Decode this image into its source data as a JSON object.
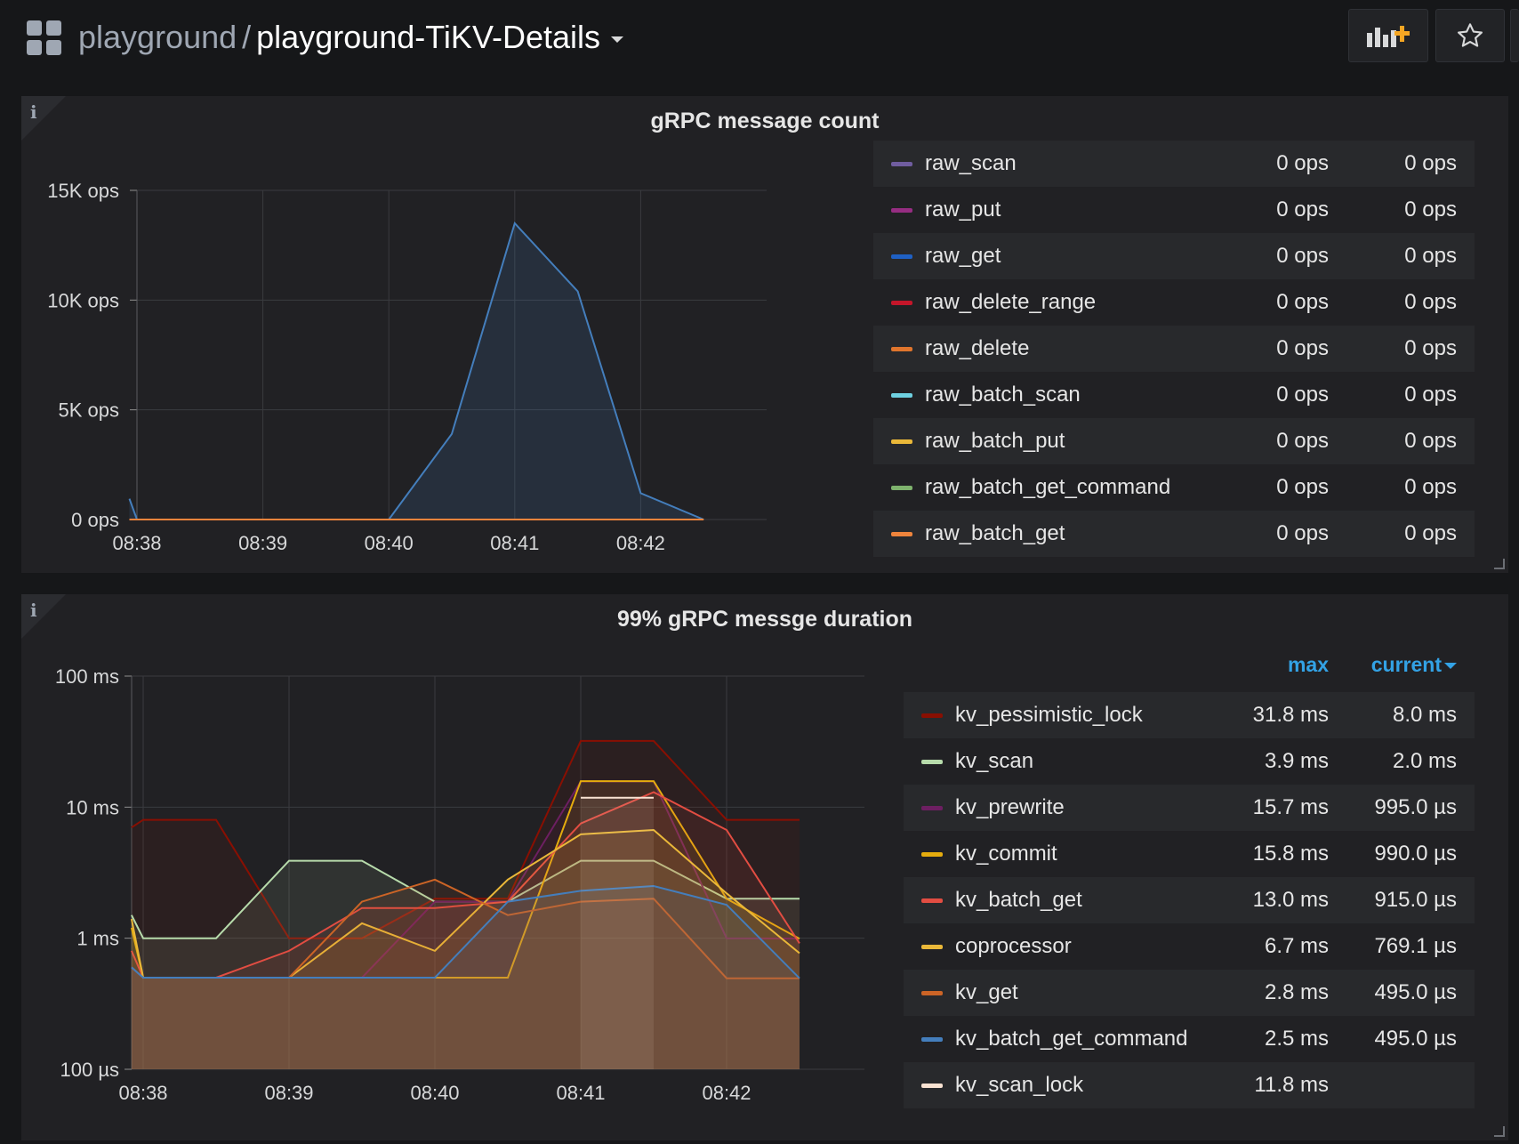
{
  "header": {
    "folder": "playground",
    "separator": "/",
    "dashboard_title": "playground-TiKV-Details"
  },
  "panels": [
    {
      "title": "gRPC message count",
      "legend": {
        "rows": [
          {
            "name": "raw_scan",
            "color": "#705da0",
            "max": "0 ops",
            "current": "0 ops"
          },
          {
            "name": "raw_put",
            "color": "#962d82",
            "max": "0 ops",
            "current": "0 ops"
          },
          {
            "name": "raw_get",
            "color": "#1f60c4",
            "max": "0 ops",
            "current": "0 ops"
          },
          {
            "name": "raw_delete_range",
            "color": "#c4162a",
            "max": "0 ops",
            "current": "0 ops"
          },
          {
            "name": "raw_delete",
            "color": "#e0752d",
            "max": "0 ops",
            "current": "0 ops"
          },
          {
            "name": "raw_batch_scan",
            "color": "#6ed0e0",
            "max": "0 ops",
            "current": "0 ops"
          },
          {
            "name": "raw_batch_put",
            "color": "#eab839",
            "max": "0 ops",
            "current": "0 ops"
          },
          {
            "name": "raw_batch_get_command",
            "color": "#7eb26d",
            "max": "0 ops",
            "current": "0 ops"
          },
          {
            "name": "raw_batch_get",
            "color": "#ef843c",
            "max": "0 ops",
            "current": "0 ops"
          }
        ]
      }
    },
    {
      "title": "99% gRPC messge duration",
      "legend": {
        "max_header": "max",
        "current_header": "current",
        "rows": [
          {
            "name": "kv_pessimistic_lock",
            "color": "#890f02",
            "max": "31.8 ms",
            "current": "8.0 ms"
          },
          {
            "name": "kv_scan",
            "color": "#b7dbab",
            "max": "3.9 ms",
            "current": "2.0 ms"
          },
          {
            "name": "kv_prewrite",
            "color": "#6d1f62",
            "max": "15.7 ms",
            "current": "995.0 µs"
          },
          {
            "name": "kv_commit",
            "color": "#e5ac0e",
            "max": "15.8 ms",
            "current": "990.0 µs"
          },
          {
            "name": "kv_batch_get",
            "color": "#e24d42",
            "max": "13.0 ms",
            "current": "915.0 µs"
          },
          {
            "name": "coprocessor",
            "color": "#eab839",
            "max": "6.7 ms",
            "current": "769.1 µs"
          },
          {
            "name": "kv_get",
            "color": "#cc6426",
            "max": "2.8 ms",
            "current": "495.0 µs"
          },
          {
            "name": "kv_batch_get_command",
            "color": "#447ebc",
            "max": "2.5 ms",
            "current": "495.0 µs"
          },
          {
            "name": "kv_scan_lock",
            "color": "#f9e2d2",
            "max": "11.8 ms",
            "current": ""
          }
        ]
      }
    }
  ],
  "chart_data": [
    {
      "type": "area",
      "title": "gRPC message count",
      "y_tick_labels": [
        "0 ops",
        "5K ops",
        "10K ops",
        "15K ops"
      ],
      "ylim": [
        0,
        15000
      ],
      "x_tick_labels": [
        "08:38",
        "08:39",
        "08:40",
        "08:41",
        "08:42"
      ],
      "xlim_minutes": [
        0,
        5
      ],
      "x_minutes_since_0838": [
        -0.06,
        0,
        2,
        2.5,
        3,
        3.5,
        4,
        4.5
      ],
      "series": [
        {
          "name": "raw_get",
          "color": "#447ebc",
          "values": [
            950,
            0,
            0,
            3900,
            13500,
            10400,
            1200,
            0
          ]
        },
        {
          "name": "raw_batch_get",
          "color": "#ef843c",
          "values": [
            0,
            0,
            0,
            0,
            0,
            0,
            0,
            0
          ]
        }
      ],
      "grid": true
    },
    {
      "type": "line",
      "title": "99% gRPC messge duration",
      "y_scale": "log",
      "y_tick_labels": [
        "100 µs",
        "1 ms",
        "10 ms",
        "100 ms"
      ],
      "ylim_ms": [
        0.1,
        100
      ],
      "x_tick_labels": [
        "08:38",
        "08:39",
        "08:40",
        "08:41",
        "08:42"
      ],
      "xlim_minutes": [
        -0.08,
        5
      ],
      "x_minutes_since_0838": [
        -0.08,
        0,
        0.5,
        1,
        1.5,
        2,
        2.5,
        3,
        3.5,
        4,
        4.5
      ],
      "series": [
        {
          "name": "kv_pessimistic_lock",
          "color": "#890f02",
          "values": [
            7.0,
            8.0,
            8.0,
            1.0,
            1.0,
            2.0,
            2.0,
            32.0,
            32.0,
            8.0,
            8.0
          ]
        },
        {
          "name": "kv_scan",
          "color": "#b7dbab",
          "values": [
            1.5,
            1.0,
            1.0,
            3.9,
            3.9,
            1.9,
            1.9,
            3.9,
            3.9,
            2.0,
            2.0
          ]
        },
        {
          "name": "kv_prewrite",
          "color": "#6d1f62",
          "values": [
            0.6,
            0.5,
            0.5,
            0.5,
            0.5,
            1.9,
            1.9,
            15.7,
            15.7,
            1.0,
            0.995
          ]
        },
        {
          "name": "kv_commit",
          "color": "#e5ac0e",
          "values": [
            1.2,
            0.5,
            0.5,
            0.5,
            0.5,
            0.5,
            0.5,
            15.8,
            15.8,
            2.0,
            0.99
          ]
        },
        {
          "name": "kv_batch_get",
          "color": "#e24d42",
          "values": [
            0.8,
            0.5,
            0.5,
            0.8,
            1.7,
            1.7,
            1.9,
            7.5,
            13.0,
            6.7,
            0.915
          ]
        },
        {
          "name": "coprocessor",
          "color": "#eab839",
          "values": [
            1.4,
            0.5,
            0.5,
            0.5,
            1.3,
            0.8,
            2.8,
            6.2,
            6.7,
            2.2,
            0.769
          ]
        },
        {
          "name": "kv_get",
          "color": "#cc6426",
          "values": [
            0.6,
            0.5,
            0.5,
            0.5,
            1.9,
            2.8,
            1.5,
            1.9,
            2.0,
            0.495,
            0.495
          ]
        },
        {
          "name": "kv_batch_get_command",
          "color": "#447ebc",
          "values": [
            0.6,
            0.5,
            0.5,
            0.5,
            0.5,
            0.5,
            1.9,
            2.3,
            2.5,
            1.8,
            0.495
          ]
        },
        {
          "name": "kv_scan_lock",
          "color": "#f9e2d2",
          "values": [
            null,
            null,
            null,
            null,
            null,
            null,
            null,
            11.8,
            11.8,
            null,
            null
          ]
        }
      ],
      "grid": true
    }
  ]
}
